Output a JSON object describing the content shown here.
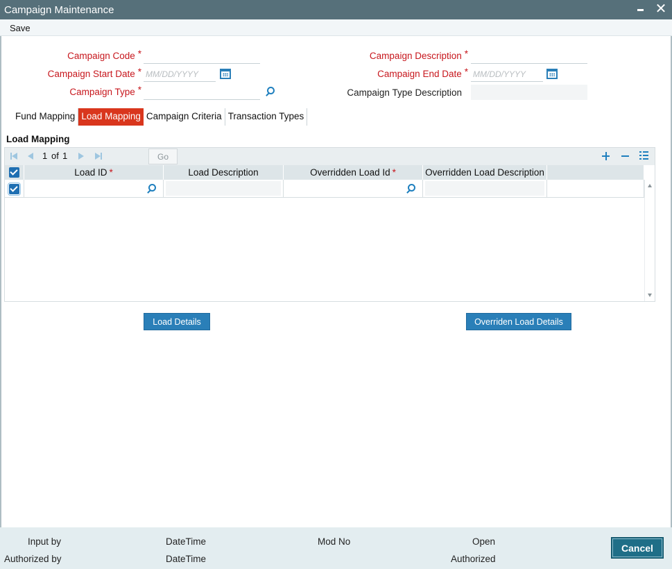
{
  "window": {
    "title": "Campaign Maintenance",
    "close_glyph": "✕"
  },
  "menu": {
    "save_label": "Save"
  },
  "form": {
    "campaign_code_label": "Campaign Code",
    "campaign_code_value": "",
    "campaign_description_label": "Campaign Description",
    "campaign_description_value": "",
    "start_date_label": "Campaign Start Date",
    "start_date_placeholder": "MM/DD/YYYY",
    "end_date_label": "Campaign End Date",
    "end_date_placeholder": "MM/DD/YYYY",
    "campaign_type_label": "Campaign Type",
    "campaign_type_value": "",
    "campaign_type_description_label": "Campaign Type Description",
    "campaign_type_description_value": "",
    "required_mark": "*"
  },
  "tabs": [
    {
      "label": "Fund Mapping",
      "active": false
    },
    {
      "label": "Load Mapping",
      "active": true
    },
    {
      "label": "Campaign Criteria",
      "active": false
    },
    {
      "label": "Transaction Types",
      "active": false
    }
  ],
  "section": {
    "title": "Load Mapping"
  },
  "grid": {
    "pager": {
      "current": "1",
      "of_label": "of",
      "total": "1",
      "go_label": "Go"
    },
    "columns": [
      {
        "label": "Load ID",
        "required": true
      },
      {
        "label": "Load Description",
        "required": false
      },
      {
        "label": "Overridden Load Id",
        "required": true
      },
      {
        "label": "Overridden Load Description",
        "required": false
      }
    ],
    "required_mark": "*",
    "rows": [
      {
        "checked": true,
        "load_id": "",
        "load_description": "",
        "overridden_load_id": "",
        "overridden_load_description": ""
      }
    ]
  },
  "buttons": {
    "load_details": "Load Details",
    "overriden_load_details": "Overriden Load Details"
  },
  "footer": {
    "input_by_label": "Input by",
    "datetime_label_1": "DateTime",
    "mod_no_label": "Mod No",
    "open_label": "Open",
    "authorized_by_label": "Authorized by",
    "datetime_label_2": "DateTime",
    "authorized_label": "Authorized",
    "cancel_label": "Cancel"
  },
  "colors": {
    "title_bar": "#56707a",
    "required_label": "#c7161c",
    "active_tab": "#d9361d",
    "primary_button": "#2a7fb8",
    "cancel_button": "#1f6e87",
    "footer_bg": "#e3edf0"
  },
  "icons": {
    "minimize": "minimize-icon",
    "close": "close-icon",
    "calendar": "calendar-icon",
    "lookup": "search-icon",
    "pager_first": "first-page-icon",
    "pager_prev": "previous-page-icon",
    "pager_next": "next-page-icon",
    "pager_last": "last-page-icon",
    "add_row": "plus-icon",
    "delete_row": "minus-icon",
    "single_view": "list-view-icon"
  }
}
